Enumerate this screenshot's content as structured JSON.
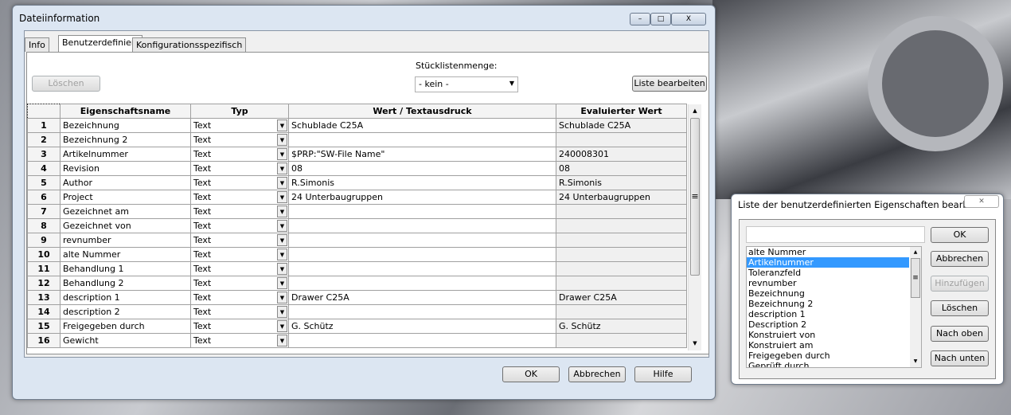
{
  "main_dialog": {
    "title": "Dateiinformation",
    "tabs": [
      {
        "label": "Info"
      },
      {
        "label": "Benutzerdefiniert",
        "active": true
      },
      {
        "label": "Konfigurationsspezifisch"
      }
    ],
    "delete_button": "Löschen",
    "bom_qty_label": "Stücklistenmenge:",
    "bom_qty_value": "- kein -",
    "edit_list_button": "Liste bearbeiten",
    "columns": [
      "Eigenschaftsname",
      "Typ",
      "Wert / Textausdruck",
      "Evaluierter Wert"
    ],
    "rows": [
      {
        "n": "1",
        "name": "Bezeichnung",
        "type": "Text",
        "value": "Schublade  C25A",
        "eval": "Schublade  C25A"
      },
      {
        "n": "2",
        "name": "Bezeichnung 2",
        "type": "Text",
        "value": "",
        "eval": ""
      },
      {
        "n": "3",
        "name": "Artikelnummer",
        "type": "Text",
        "value": "$PRP:\"SW-File Name\"",
        "eval": "240008301"
      },
      {
        "n": "4",
        "name": "Revision",
        "type": "Text",
        "value": "08",
        "eval": "08"
      },
      {
        "n": "5",
        "name": "Author",
        "type": "Text",
        "value": "R.Simonis",
        "eval": "R.Simonis"
      },
      {
        "n": "6",
        "name": "Project",
        "type": "Text",
        "value": "24 Unterbaugruppen",
        "eval": "24 Unterbaugruppen"
      },
      {
        "n": "7",
        "name": "Gezeichnet am",
        "type": "Text",
        "value": "",
        "eval": ""
      },
      {
        "n": "8",
        "name": "Gezeichnet von",
        "type": "Text",
        "value": "",
        "eval": ""
      },
      {
        "n": "9",
        "name": "revnumber",
        "type": "Text",
        "value": "",
        "eval": ""
      },
      {
        "n": "10",
        "name": "alte Nummer",
        "type": "Text",
        "value": "",
        "eval": ""
      },
      {
        "n": "11",
        "name": "Behandlung 1",
        "type": "Text",
        "value": "",
        "eval": ""
      },
      {
        "n": "12",
        "name": "Behandlung 2",
        "type": "Text",
        "value": "",
        "eval": ""
      },
      {
        "n": "13",
        "name": "description 1",
        "type": "Text",
        "value": "Drawer  C25A",
        "eval": "Drawer  C25A"
      },
      {
        "n": "14",
        "name": "description 2",
        "type": "Text",
        "value": "",
        "eval": ""
      },
      {
        "n": "15",
        "name": "Freigegeben durch",
        "type": "Text",
        "value": "G. Schütz",
        "eval": "G. Schütz"
      },
      {
        "n": "16",
        "name": "Gewicht",
        "type": "Text",
        "value": "",
        "eval": ""
      }
    ],
    "ok": "OK",
    "cancel": "Abbrechen",
    "help": "Hilfe"
  },
  "list_dialog": {
    "title": "Liste der benutzerdefinierten Eigenschaften bearb...",
    "input_value": "",
    "items": [
      "alte Nummer",
      "Artikelnummer",
      "Toleranzfeld",
      "revnumber",
      "Bezeichnung",
      "Bezeichnung 2",
      "description 1",
      "Description 2",
      "Konstruiert von",
      "Konstruiert am",
      "Freigegeben durch",
      "Geprüft durch"
    ],
    "selected": "Artikelnummer",
    "buttons": [
      "OK",
      "Abbrechen",
      "Hinzufügen",
      "Löschen",
      "Nach oben",
      "Nach unten"
    ]
  },
  "colors": {
    "selection": "#3399ff",
    "frame": "#dce6f2"
  }
}
